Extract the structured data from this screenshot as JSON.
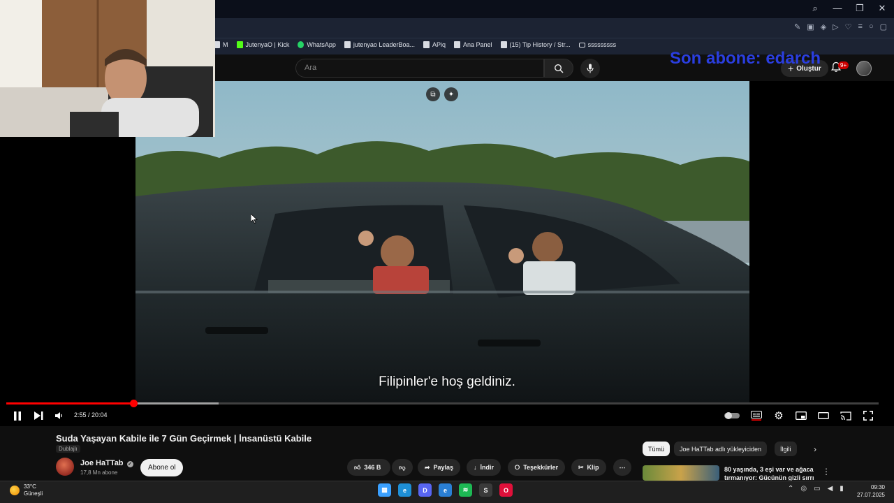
{
  "browser": {
    "bookmarks": [
      {
        "label": "M",
        "icon": "doc-icon"
      },
      {
        "label": "JutenyaO | Kick",
        "icon": "kick-icon"
      },
      {
        "label": "WhatsApp",
        "icon": "whatsapp-icon"
      },
      {
        "label": "jutenyao LeaderBoa...",
        "icon": "doc-icon"
      },
      {
        "label": "APiq",
        "icon": "doc-icon"
      },
      {
        "label": "Ana Panel",
        "icon": "doc-icon"
      },
      {
        "label": "(15) Tip History / Str...",
        "icon": "doc-icon"
      },
      {
        "label": "sssssssss",
        "icon": "folder-icon"
      }
    ]
  },
  "masthead": {
    "search_placeholder": "Ara",
    "create_label": "Oluştur",
    "notification_count": "9+"
  },
  "stream_overlay": {
    "last_subscriber": "Son abone: edarch"
  },
  "player": {
    "caption": "Filipinler'e hoş geldiniz.",
    "time_display": "2:55 / 20:04",
    "progress_played": 0.146,
    "progress_buffered": 0.243
  },
  "video": {
    "title": "Suda Yaşayan Kabile ile 7 Gün Geçirmek | İnsanüstü Kabile",
    "dubbed_label": "Dublajlı",
    "channel_name": "Joe HaTTab",
    "channel_subs": "17,8 Mn abone",
    "subscribe_label": "Abone ol",
    "like_count": "346 B",
    "share_label": "Paylaş",
    "download_label": "İndir",
    "thanks_label": "Teşekkürler",
    "clip_label": "Klip"
  },
  "recommendations": {
    "chips": [
      "Tümü",
      "Joe HaTTab adlı yükleyiciden",
      "İlgili"
    ],
    "first_title": "80 yaşında, 3 eşi var ve ağaca tırmanıyor: Gücünün gizli sırrı"
  },
  "taskbar": {
    "temperature": "33°C",
    "weather": "Güneşli",
    "time": "09:30",
    "date": "27.07.2025",
    "apps": [
      {
        "name": "windows-start-icon",
        "color": "#3aa0ff"
      },
      {
        "name": "edge-icon",
        "color": "#1e8fd6"
      },
      {
        "name": "discord-icon",
        "color": "#5865f2"
      },
      {
        "name": "edge-dev-icon",
        "color": "#2a7fd4"
      },
      {
        "name": "spotify-icon",
        "color": "#1db954"
      },
      {
        "name": "steam-icon",
        "color": "#3a3a3a"
      },
      {
        "name": "opera-gx-icon",
        "color": "#e0103a"
      }
    ]
  },
  "colors": {
    "accent_red": "#ff0000",
    "overlay_blue": "#2a3ee0"
  }
}
